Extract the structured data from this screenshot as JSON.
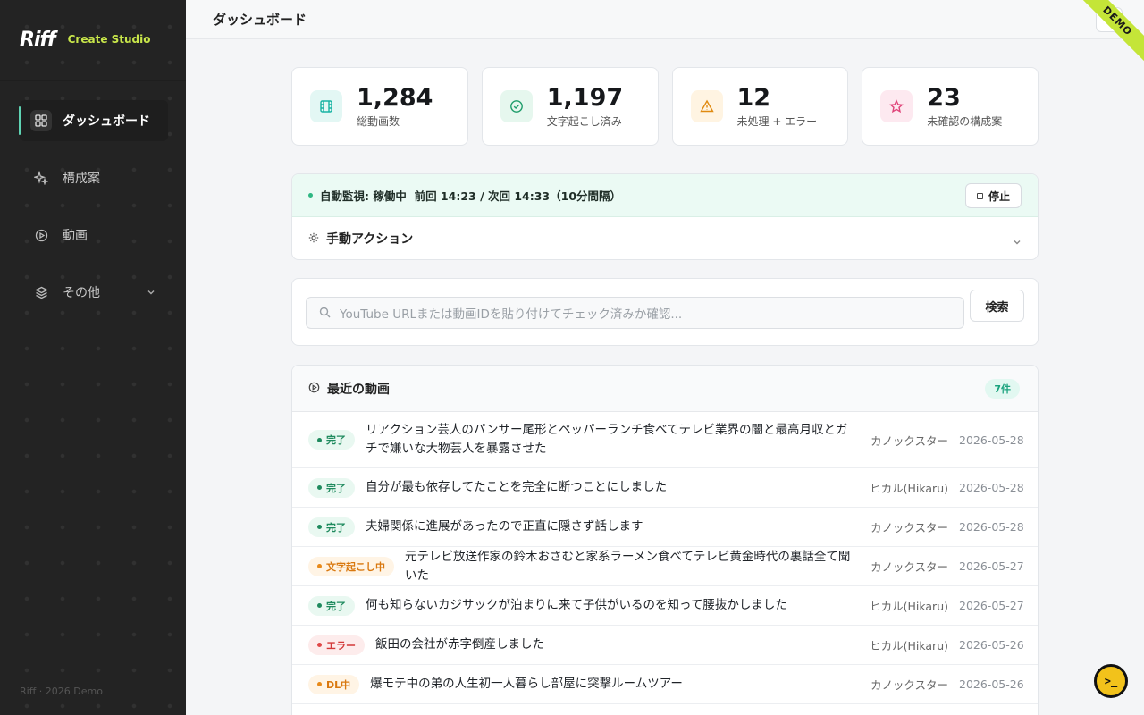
{
  "brand": {
    "logo": "Riff",
    "subtitle": "Create Studio",
    "footer": "Riff · 2026 Demo"
  },
  "sidebar": {
    "items": [
      {
        "label": "ダッシュボード",
        "icon": "dashboard-grid-icon",
        "active": true
      },
      {
        "label": "構成案",
        "icon": "sparkles-icon"
      },
      {
        "label": "動画",
        "icon": "play-circle-icon"
      },
      {
        "label": "その他",
        "icon": "layers-icon",
        "expandable": true
      }
    ]
  },
  "header": {
    "title": "ダッシュボード",
    "ribbon": "DEMO"
  },
  "stats": [
    {
      "value": "1,284",
      "label": "総動画数",
      "icon": "film-icon",
      "color": "#17b3a3"
    },
    {
      "value": "1,197",
      "label": "文字起こし済み",
      "icon": "check-circle-icon",
      "color": "#1f9d6b"
    },
    {
      "value": "12",
      "label": "未処理 + エラー",
      "icon": "warning-triangle-icon",
      "color": "#e08a10"
    },
    {
      "value": "23",
      "label": "未確認の構成案",
      "icon": "star-icon",
      "color": "#e0457a"
    }
  ],
  "monitor": {
    "status": "自動監視: 稼働中",
    "schedule": "前回 14:23 / 次回 14:33（10分間隔）",
    "stop_label": "停止",
    "manual_label": "手動アクション"
  },
  "search": {
    "placeholder": "YouTube URLまたは動画IDを貼り付けてチェック済みか確認...",
    "button": "検索"
  },
  "videos": {
    "title": "最近の動画",
    "count": "7件",
    "rows": [
      {
        "status": "完了",
        "kind": "done",
        "title": "リアクション芸人のパンサー尾形とペッパーランチ食べてテレビ業界の闇と最高月収とガチで嫌いな大物芸人を暴露させた",
        "channel": "カノックスター",
        "date": "2026-05-28"
      },
      {
        "status": "完了",
        "kind": "done",
        "title": "自分が最も依存してたことを完全に断つことにしました",
        "channel": "ヒカル(Hikaru)",
        "date": "2026-05-28"
      },
      {
        "status": "完了",
        "kind": "done",
        "title": "夫婦関係に進展があったので正直に隠さず話します",
        "channel": "カノックスター",
        "date": "2026-05-28"
      },
      {
        "status": "文字起こし中",
        "kind": "proc",
        "title": "元テレビ放送作家の鈴木おさむと家系ラーメン食べてテレビ黄金時代の裏話全て聞いた",
        "channel": "カノックスター",
        "date": "2026-05-27"
      },
      {
        "status": "完了",
        "kind": "done",
        "title": "何も知らないカジサックが泊まりに来て子供がいるのを知って腰抜かしました",
        "channel": "ヒカル(Hikaru)",
        "date": "2026-05-27"
      },
      {
        "status": "エラー",
        "kind": "err",
        "title": "飯田の会社が赤字倒産しました",
        "channel": "ヒカル(Hikaru)",
        "date": "2026-05-26"
      },
      {
        "status": "DL中",
        "kind": "proc",
        "title": "爆モテ中の弟の人生初一人暮らし部屋に突撃ルームツアー",
        "channel": "カノックスター",
        "date": "2026-05-26"
      }
    ]
  },
  "fab": {
    "label": ">_"
  }
}
